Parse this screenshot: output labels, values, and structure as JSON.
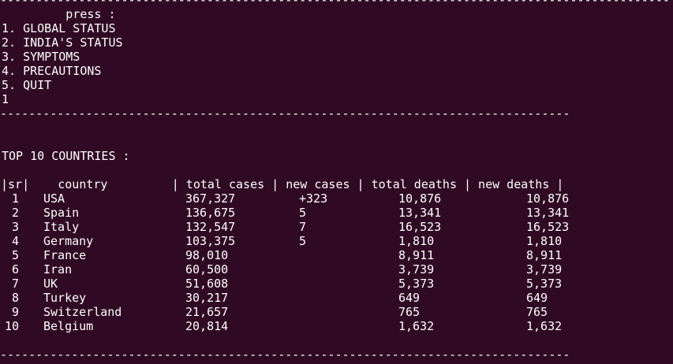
{
  "terminal": {
    "separator_top": "----------------------------------------------------------------------------------------------",
    "menu": {
      "prompt": "         press :",
      "options": [
        "1. GLOBAL STATUS",
        "2. INDIA'S STATUS",
        "3. SYMPTOMS",
        "4. PRECAUTIONS",
        "5. QUIT"
      ],
      "user_input": "1"
    },
    "separator_mid": "--------------------------------------------------------------------------------",
    "section_title": "TOP 10 COUNTRIES :",
    "table": {
      "header_line": "|sr|    country         | total cases | new cases | total deaths | new deaths |",
      "rows": [
        {
          "sr": "1",
          "country": "USA",
          "total_cases": "367,327",
          "new_cases": "+323",
          "total_deaths": "10,876",
          "new_deaths": "10,876"
        },
        {
          "sr": "2",
          "country": "Spain",
          "total_cases": "136,675",
          "new_cases": "5",
          "total_deaths": "13,341",
          "new_deaths": "13,341"
        },
        {
          "sr": "3",
          "country": "Italy",
          "total_cases": "132,547",
          "new_cases": "7",
          "total_deaths": "16,523",
          "new_deaths": "16,523"
        },
        {
          "sr": "4",
          "country": "Germany",
          "total_cases": "103,375",
          "new_cases": "5",
          "total_deaths": "1,810",
          "new_deaths": "1,810"
        },
        {
          "sr": "5",
          "country": "France",
          "total_cases": "98,010",
          "new_cases": "",
          "total_deaths": "8,911",
          "new_deaths": "8,911"
        },
        {
          "sr": "6",
          "country": "Iran",
          "total_cases": "60,500",
          "new_cases": "",
          "total_deaths": "3,739",
          "new_deaths": "3,739"
        },
        {
          "sr": "7",
          "country": "UK",
          "total_cases": "51,608",
          "new_cases": "",
          "total_deaths": "5,373",
          "new_deaths": "5,373"
        },
        {
          "sr": "8",
          "country": "Turkey",
          "total_cases": "30,217",
          "new_cases": "",
          "total_deaths": "649",
          "new_deaths": "649"
        },
        {
          "sr": "9",
          "country": "Switzerland",
          "total_cases": "21,657",
          "new_cases": "",
          "total_deaths": "765",
          "new_deaths": "765"
        },
        {
          "sr": "10",
          "country": "Belgium",
          "total_cases": "20,814",
          "new_cases": "",
          "total_deaths": "1,632",
          "new_deaths": "1,632"
        }
      ]
    },
    "separator_bottom": "--------------------------------------------------------------------------------"
  },
  "colors": {
    "background": "#300a24",
    "foreground": "#ffffff"
  }
}
